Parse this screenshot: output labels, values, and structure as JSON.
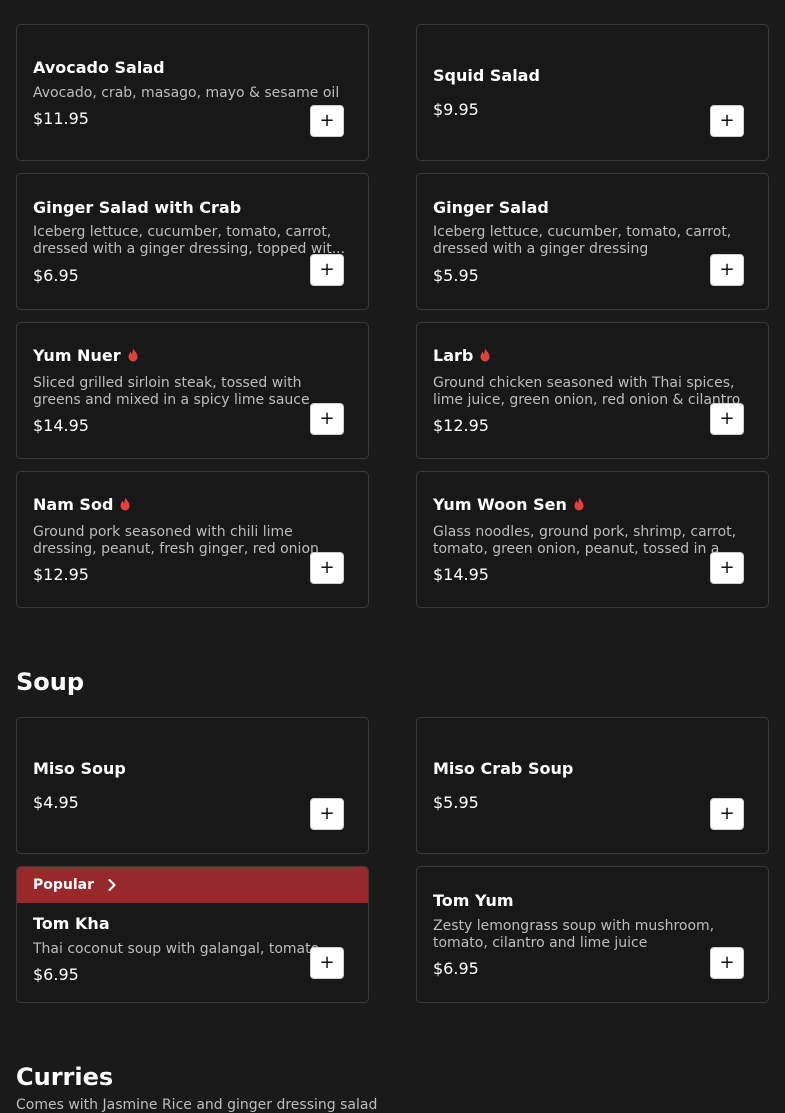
{
  "salads": [
    {
      "name": "Avocado Salad",
      "desc": "Avocado, crab, masago, mayo & sesame oil",
      "price": "$11.95",
      "spicy": false
    },
    {
      "name": "Squid Salad",
      "desc": "",
      "price": "$9.95",
      "spicy": false
    },
    {
      "name": "Ginger Salad with Crab",
      "desc": "Iceberg lettuce, cucumber, tomato, carrot, dressed with a ginger dressing, topped wit...",
      "price": "$6.95",
      "spicy": false
    },
    {
      "name": "Ginger Salad",
      "desc": "Iceberg lettuce, cucumber, tomato, carrot, dressed with a ginger dressing",
      "price": "$5.95",
      "spicy": false
    },
    {
      "name": "Yum Nuer",
      "desc": "Sliced grilled sirloin steak, tossed with greens and mixed in a spicy lime sauce",
      "price": "$14.95",
      "spicy": true
    },
    {
      "name": "Larb",
      "desc": "Ground chicken seasoned with Thai spices, lime juice, green onion, red onion & cilantro",
      "price": "$12.95",
      "spicy": true
    },
    {
      "name": "Nam Sod",
      "desc": "Ground pork seasoned with chili lime dressing, peanut, fresh ginger, red onion",
      "price": "$12.95",
      "spicy": true
    },
    {
      "name": "Yum Woon Sen",
      "desc": "Glass noodles, ground pork, shrimp, carrot, tomato, green onion, peanut, tossed in a",
      "price": "$14.95",
      "spicy": true
    }
  ],
  "soup": {
    "title": "Soup",
    "items": [
      {
        "name": "Miso Soup",
        "desc": "",
        "price": "$4.95"
      },
      {
        "name": "Miso Crab Soup",
        "desc": "",
        "price": "$5.95"
      },
      {
        "name": "Tom Kha",
        "desc": "Thai coconut soup with galangal, tomato",
        "price": "$6.95",
        "badge": "Popular"
      },
      {
        "name": "Tom Yum",
        "desc": "Zesty lemongrass soup with mushroom, tomato, cilantro and lime juice",
        "price": "$6.95"
      }
    ]
  },
  "curries": {
    "title": "Curries",
    "note": "Comes with Jasmine Rice and ginger dressing salad"
  },
  "add_symbol": "+",
  "icons": {
    "spicy": "flame-icon",
    "add": "plus-icon",
    "badge": "chevron-right-icon"
  },
  "colors": {
    "background": "#1a1a1a",
    "badge": "#97282b",
    "flame": "#e2403d"
  }
}
